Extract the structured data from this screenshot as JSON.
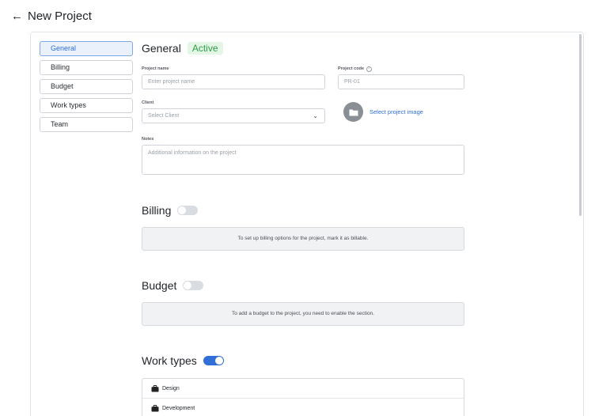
{
  "header": {
    "back_icon": "arrow-left-icon",
    "title": "New Project"
  },
  "nav": {
    "items": [
      {
        "label": "General",
        "active": true
      },
      {
        "label": "Billing",
        "active": false
      },
      {
        "label": "Budget",
        "active": false
      },
      {
        "label": "Work types",
        "active": false
      },
      {
        "label": "Team",
        "active": false
      }
    ]
  },
  "general": {
    "title": "General",
    "status_badge": "Active",
    "project_name": {
      "label": "Project name",
      "placeholder": "Enter project name"
    },
    "project_code": {
      "label": "Project code",
      "placeholder": "PR-01",
      "help_icon": "question-circle-icon"
    },
    "client": {
      "label": "Client",
      "selected": "Select Client"
    },
    "image": {
      "label": "Select project image",
      "icon": "folder-icon"
    },
    "notes": {
      "label": "Notes",
      "placeholder": "Additional information on the project"
    }
  },
  "billing": {
    "title": "Billing",
    "enabled": false,
    "info": "To set up billing options for the project, mark it as billable."
  },
  "budget": {
    "title": "Budget",
    "enabled": false,
    "info": "To add a budget to the project, you need to enable the section."
  },
  "work_types": {
    "title": "Work types",
    "enabled": true,
    "items": [
      {
        "label": "Design",
        "icon": "briefcase-icon"
      },
      {
        "label": "Development",
        "icon": "briefcase-icon"
      }
    ]
  },
  "colors": {
    "accent": "#2f6fd6",
    "active_badge_bg": "#e4f6e6",
    "active_badge_text": "#2e9e45",
    "toggle_off": "#d9dce0"
  }
}
